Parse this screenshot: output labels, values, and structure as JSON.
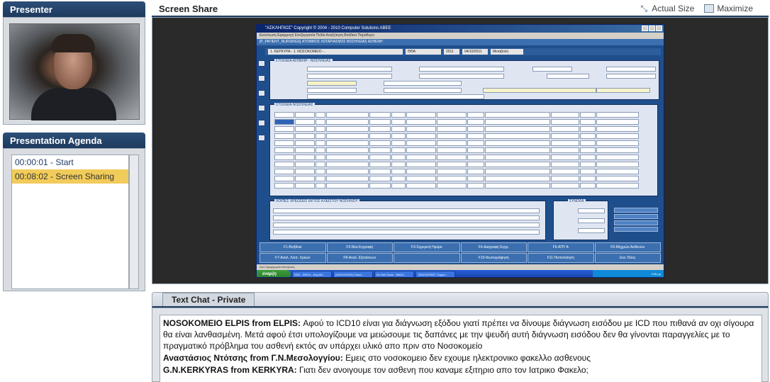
{
  "presenter": {
    "title": "Presenter"
  },
  "agenda": {
    "title": "Presentation Agenda",
    "items": [
      {
        "label": "00:00:01 - Start",
        "active": false
      },
      {
        "label": "00:08:02 - Screen Sharing",
        "active": true
      }
    ]
  },
  "screen_share": {
    "title": "Screen Share",
    "actual_size_label": "Actual Size",
    "maximize_label": "Maximize",
    "remote": {
      "window_title": "\"ΑΣΚΛΗΠΙΟΣ\" Copyright © 2004 - 2010 Computer Solutions ABEE",
      "menu": "Εκτύπωση  Εφαρμογή  Επεξεργασία  Πεδία  Αναζήτηση  Βοήθεια  Παράθυρο",
      "app_topbar": "[P_PATIENT_NURSINGS]          ΑΤΟΜΙΚΟΣ ΛΟΓΑΡΙΑΣΜΟΣ ΝΟΣΗΛΕΙΑΣ ΑΣΘΕΝΗ",
      "infobar": [
        "1. ΚΕΡΚΥΡΑ - 1. ΝΟΣΟΚΟΜΕΙΟ - .",
        "ΘΘΑ",
        "2011",
        "04/10/2011",
        "Μεταβολή"
      ],
      "section_patient": "ΣΤΟΙΧΕΙΑ ΑΣΘΕΝΗ - ΝΟΣΗΛΕΙΑΣ",
      "section_nursing": "ΣΤΟΙΧΕΙΑ ΝΟΣΗΛΕΙΑΣ",
      "section_expenses": "ΛΟΙΠΕΣ ΧΡΕΩΣΕΙΣ ΕΚΤΟΣ ΚΛΕΙΣΤΟΥ ΝΟΣΗΛΙΟΥ",
      "section_sum": "ΣΥΝΟΛΑ",
      "buttons": [
        "F1-Βοήθεια",
        "F2-Νέα Εγγραφή",
        "F3-Σημερινή Ημέρα",
        "F4-Διαγραφή Εγγρ.",
        "F5-ΑΠΥ Α",
        "F6-Μηχρώο Ασθενών",
        "F7-Αναλ. Λοιπ. Χρεών",
        "F8-Αναλ. Εξετάσεων",
        "",
        "F10-Φωτογράφηση",
        "F11-Πιστοποίηση",
        "Esc-Τέλος"
      ],
      "statusbar": "Από Ημερομηνία Νοσηλείας",
      "start_label": "έναρξη",
      "tasks": [
        "KEN - DRG's - Any.Me...",
        "(ΑΣΚΛΗΠΙΟΣ) Οικον...",
        "Do Not Close - WebU...",
        "\"ΑΣΚΛΗΠΙΟΣ\" Copyri..."
      ],
      "clock": "3:05 μμ"
    }
  },
  "chat": {
    "tab_label": "Text Chat - Private",
    "messages": [
      {
        "sender": "NOSOKOMEIO ELPIS from ELPIS:",
        "text": " Αφού το ICD10 είναι για διάγνωση εξόδου γιατί πρέπει να δίνουμε διάγνωση εισόδου με ICD που πιθανά αν οχι σίγουρα θα είναι λανθασμένη. Μετά αφού έτσι υπολογίζουμε να μειώσουμε τις δαπάνες με την ψευδή αυτή διάγνωση εισόδου δεν θα γίνονται  παραγγελίες με το πραγματικό πρόβλημα του ασθενή εκτός αν υπάρχει υλικό απο πριν στο Νοσοκομείο"
      },
      {
        "sender": "Αναστάσιος Ντότσης from Γ.Ν.Μεσολογγίου:",
        "text": " Εμεις στο νοσοκομειο δεν εχουμε ηλεκτρονικο φακελλο ασθενους"
      },
      {
        "sender": "G.N.KERKYRAS from KERKYRA:",
        "text": " Γιατι δεν ανοιγουμε τον ασθενη που καναμε εξιτηριο απο τον Ιατρικο Φακελο;"
      }
    ]
  }
}
